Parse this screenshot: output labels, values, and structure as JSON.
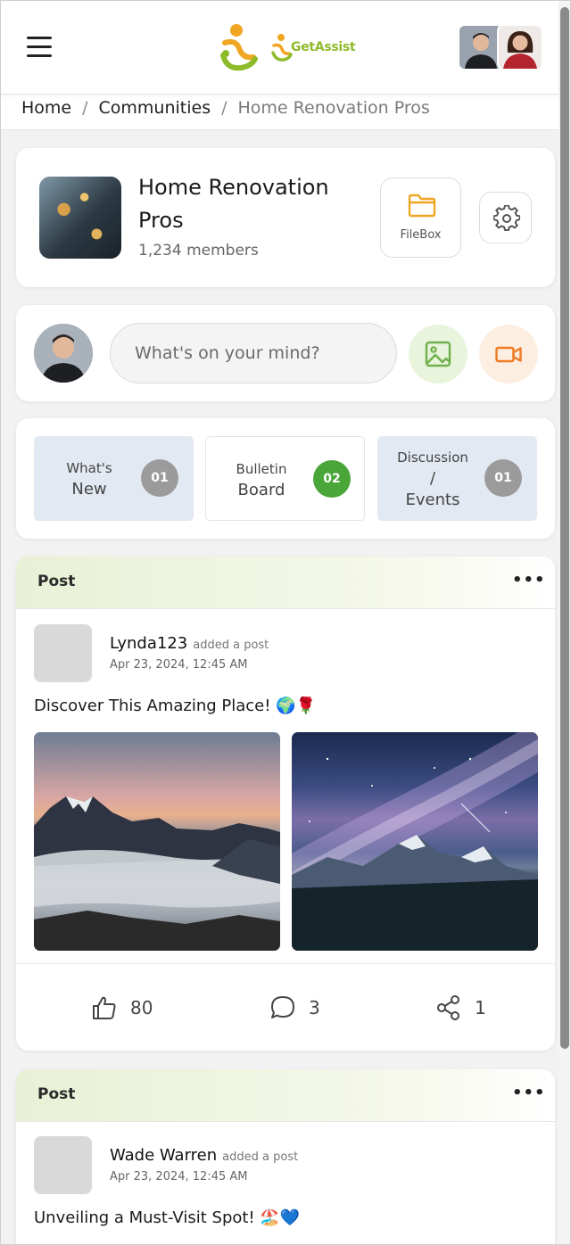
{
  "header": {
    "logo_text": "GetAssist",
    "brand_color": "#8dbb2a",
    "accent_color": "#f0a623"
  },
  "breadcrumb": {
    "items": [
      "Home",
      "Communities",
      "Home Renovation Pros"
    ],
    "separator": "/"
  },
  "community": {
    "name": "Home Renovation Pros",
    "members": "1,234 members",
    "filebox_label": "FileBox",
    "filebox_icon": "folder-icon",
    "settings_icon": "gear-icon"
  },
  "composer": {
    "placeholder": "What's on your mind?",
    "photo_icon": "image-icon",
    "video_icon": "video-camera-icon"
  },
  "tabs": [
    {
      "line1": "What's",
      "line2": "New",
      "count": "01",
      "active": false
    },
    {
      "line1": "Bulletin",
      "line2": "Board",
      "count": "02",
      "active": true
    },
    {
      "line1": "Discussion",
      "line2": "/",
      "line3": "Events",
      "count": "01",
      "active": false
    }
  ],
  "posts": [
    {
      "header": "Post",
      "author": "Lynda123",
      "action": "added a post",
      "date": "Apr 23, 2024, 12:45 AM",
      "text": "Discover This Amazing Place! 🌍🌹",
      "likes": "80",
      "comments": "3",
      "shares": "1"
    },
    {
      "header": "Post",
      "author": "Wade Warren",
      "action": "added a post",
      "date": "Apr 23, 2024, 12:45 AM",
      "text": "Unveiling a Must-Visit Spot! 🏖️💙"
    }
  ],
  "colors": {
    "count_active": "#4ba63a",
    "count_inactive": "#9b9b9b",
    "tab_bg": "#e3e9f2",
    "photo_bg": "#e8f4dc",
    "video_bg": "#fdeee2"
  }
}
